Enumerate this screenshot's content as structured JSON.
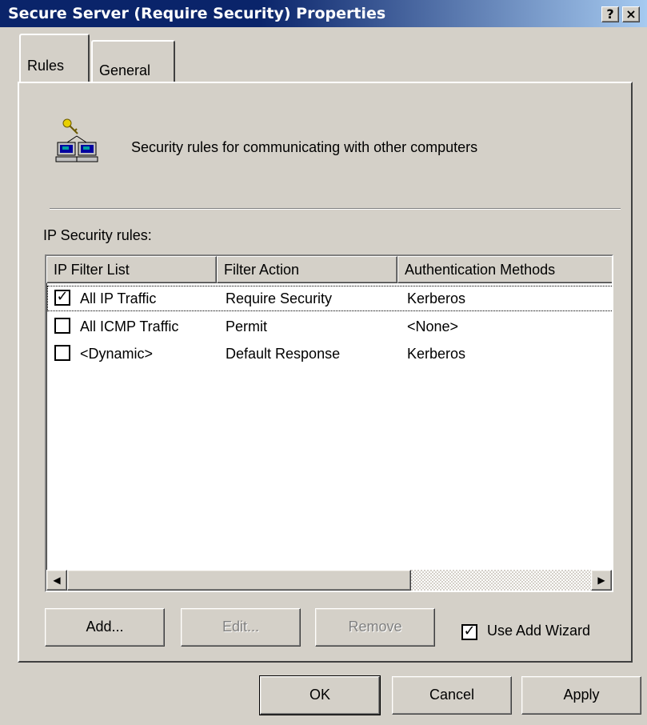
{
  "window": {
    "title": "Secure Server (Require Security) Properties",
    "help_glyph": "?",
    "close_glyph": "×"
  },
  "tabs": [
    {
      "label": "Rules",
      "selected": true
    },
    {
      "label": "General",
      "selected": false
    }
  ],
  "rules_tab": {
    "header_icon": "networked-computers-key-icon",
    "header_text": "Security rules for communicating with other computers",
    "list_label": "IP Security rules:",
    "columns": [
      "IP Filter List",
      "Filter Action",
      "Authentication Methods"
    ],
    "rows": [
      {
        "checked": true,
        "filter_list": "All IP Traffic",
        "filter_action": "Require Security",
        "auth": "Kerberos"
      },
      {
        "checked": false,
        "filter_list": "All ICMP Traffic",
        "filter_action": "Permit",
        "auth": "<None>"
      },
      {
        "checked": false,
        "filter_list": "<Dynamic>",
        "filter_action": "Default Response",
        "auth": "Kerberos"
      }
    ],
    "scroll_left_glyph": "◀",
    "scroll_right_glyph": "▶",
    "buttons": {
      "add": "Add...",
      "edit": "Edit...",
      "remove": "Remove"
    },
    "use_add_wizard": {
      "label": "Use Add Wizard",
      "checked": true
    }
  },
  "footer": {
    "ok": "OK",
    "cancel": "Cancel",
    "apply": "Apply"
  },
  "colors": {
    "titlebar_start": "#0a246a",
    "titlebar_end": "#a6caf0",
    "face": "#d4d0c8"
  }
}
